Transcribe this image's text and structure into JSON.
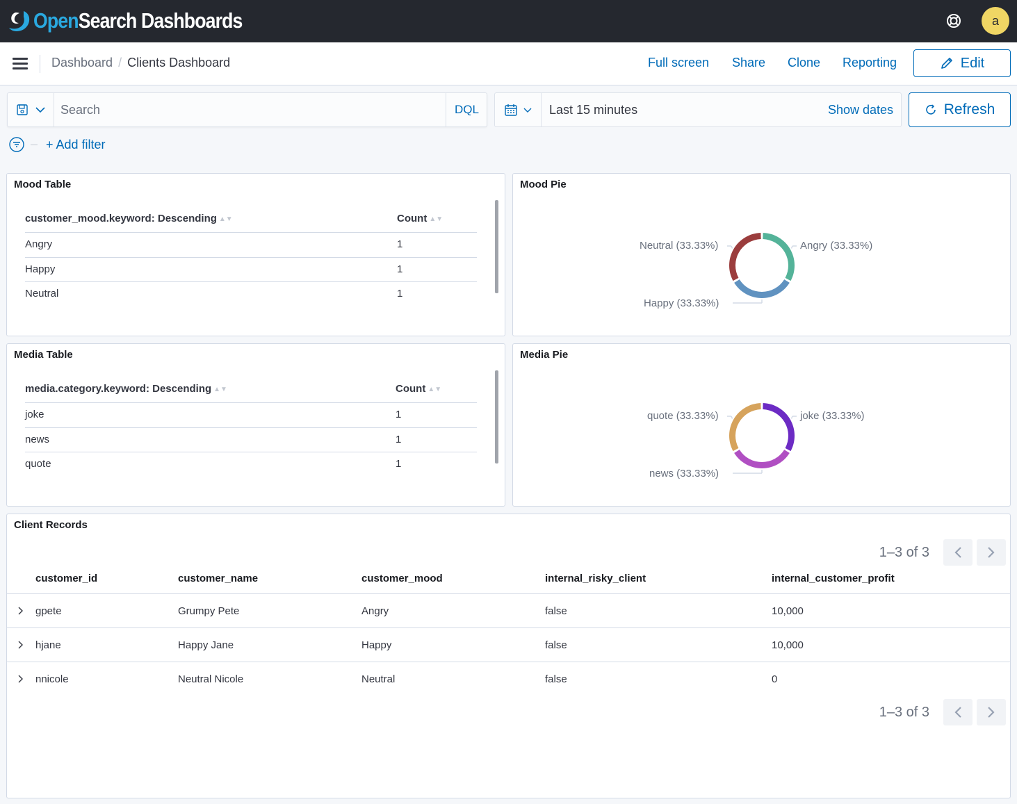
{
  "app": {
    "logo_open": "Open",
    "logo_rest": "Search Dashboards",
    "avatar_letter": "a",
    "brand_color": "#2aa9e0",
    "accent_color": "#006bb8"
  },
  "nav": {
    "breadcrumbs": [
      "Dashboard",
      "Clients Dashboard"
    ],
    "separator": "/",
    "links": [
      "Full screen",
      "Share",
      "Clone",
      "Reporting"
    ],
    "edit_label": "Edit"
  },
  "query": {
    "search_placeholder": "Search",
    "language": "DQL",
    "time_range": "Last 15 minutes",
    "show_dates": "Show dates",
    "refresh_label": "Refresh",
    "add_filter": "+ Add filter"
  },
  "panels": {
    "mood_table": {
      "title": "Mood Table",
      "col1": "customer_mood.keyword: Descending",
      "col2": "Count",
      "rows": [
        {
          "key": "Angry",
          "count": "1"
        },
        {
          "key": "Happy",
          "count": "1"
        },
        {
          "key": "Neutral",
          "count": "1"
        }
      ]
    },
    "mood_pie": {
      "title": "Mood Pie",
      "labels": [
        "Angry (33.33%)",
        "Happy (33.33%)",
        "Neutral (33.33%)"
      ]
    },
    "media_table": {
      "title": "Media Table",
      "col1": "media.category.keyword: Descending",
      "col2": "Count",
      "rows": [
        {
          "key": "joke",
          "count": "1"
        },
        {
          "key": "news",
          "count": "1"
        },
        {
          "key": "quote",
          "count": "1"
        }
      ]
    },
    "media_pie": {
      "title": "Media Pie",
      "labels": [
        "joke (33.33%)",
        "news (33.33%)",
        "quote (33.33%)"
      ]
    },
    "client_records": {
      "title": "Client Records",
      "pager_text": "1–3 of 3",
      "columns": [
        "customer_id",
        "customer_name",
        "customer_mood",
        "internal_risky_client",
        "internal_customer_profit"
      ],
      "rows": [
        [
          "gpete",
          "Grumpy Pete",
          "Angry",
          "false",
          "10,000"
        ],
        [
          "hjane",
          "Happy Jane",
          "Happy",
          "false",
          "10,000"
        ],
        [
          "nnicole",
          "Neutral Nicole",
          "Neutral",
          "false",
          "0"
        ]
      ]
    }
  },
  "chart_data": [
    {
      "type": "pie",
      "donut": true,
      "categories": [
        "Angry",
        "Happy",
        "Neutral"
      ],
      "values": [
        33.33,
        33.33,
        33.33
      ],
      "colors": [
        "#54b399",
        "#6092c0",
        "#9b3d3d"
      ]
    },
    {
      "type": "pie",
      "donut": true,
      "categories": [
        "joke",
        "news",
        "quote"
      ],
      "values": [
        33.33,
        33.33,
        33.33
      ],
      "colors": [
        "#6c2bc4",
        "#b04fc2",
        "#d6a35c"
      ]
    }
  ]
}
